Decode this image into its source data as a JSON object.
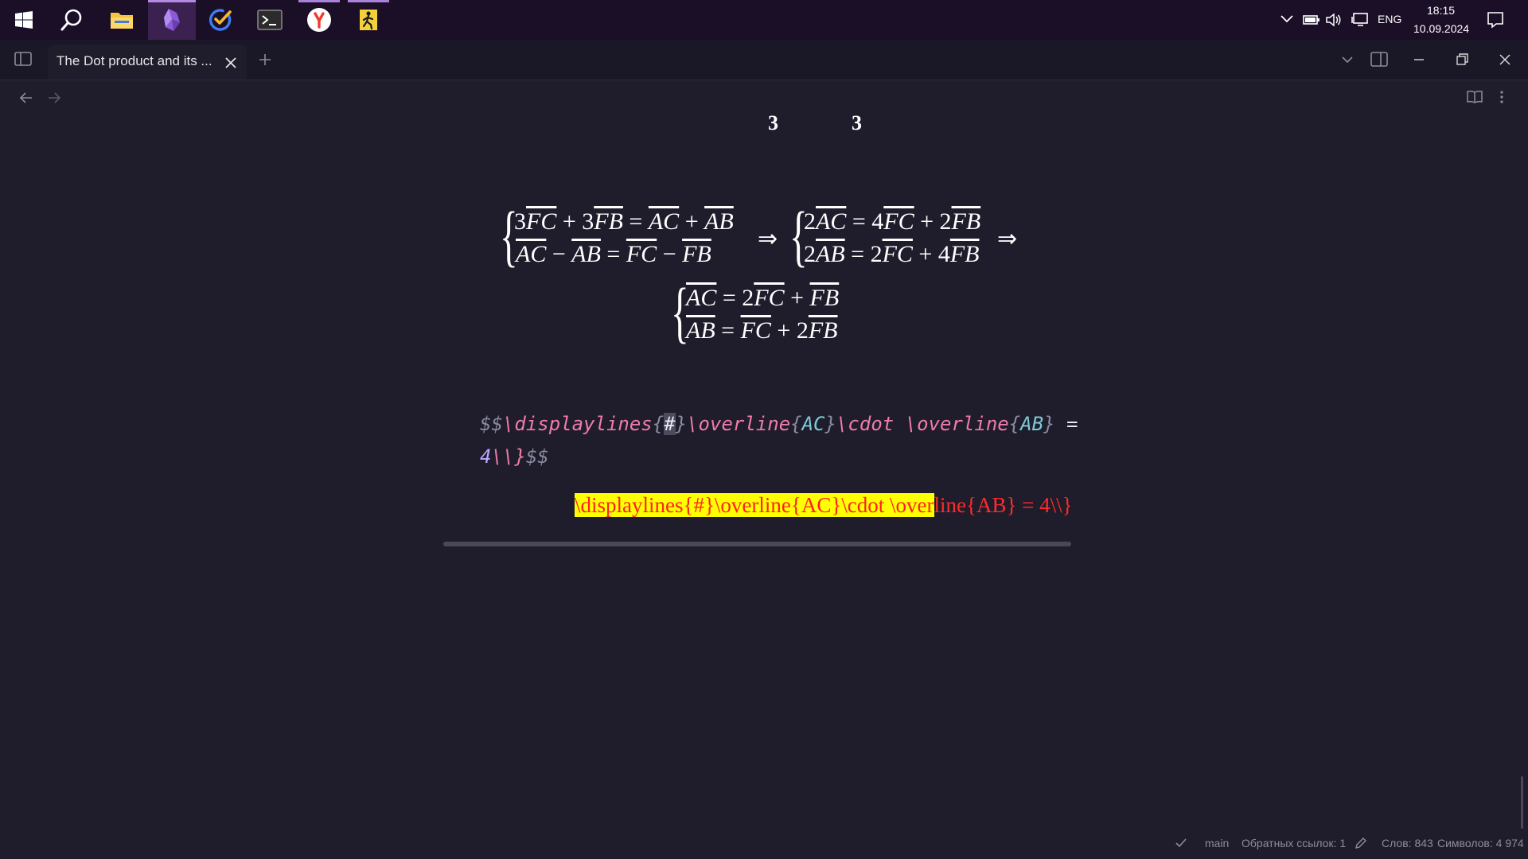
{
  "taskbar": {
    "apps": [
      {
        "name": "start-icon"
      },
      {
        "name": "search-icon"
      },
      {
        "name": "file-explorer-icon"
      },
      {
        "name": "obsidian-icon"
      },
      {
        "name": "todo-check-icon"
      },
      {
        "name": "terminal-icon"
      },
      {
        "name": "yandex-browser-icon"
      },
      {
        "name": "exit-app-icon"
      }
    ],
    "language": "ENG",
    "time": "18:15",
    "date": "10.09.2024"
  },
  "tab": {
    "title": "The Dot product and its ..."
  },
  "content": {
    "partial_line": [
      "3",
      "3"
    ],
    "system1": {
      "row1": {
        "c1": "3",
        "v1": "FC",
        "c2": "3",
        "v2": "FB",
        "v3": "AC",
        "v4": "AB"
      },
      "row2": {
        "v1": "AC",
        "v2": "AB",
        "v3": "FC",
        "v4": "FB"
      }
    },
    "system2": {
      "row1": {
        "c1": "2",
        "v1": "AC",
        "c2": "4",
        "v2": "FC",
        "c3": "2",
        "v3": "FB"
      },
      "row2": {
        "c1": "2",
        "v1": "AB",
        "c2": "2",
        "v2": "FC",
        "c3": "4",
        "v3": "FB"
      }
    },
    "system3": {
      "row1": {
        "v1": "AC",
        "c1": "2",
        "v2": "FC",
        "v3": "FB"
      },
      "row2": {
        "v1": "AB",
        "v2": "FC",
        "c1": "2",
        "v3": "FB"
      }
    },
    "source": {
      "open": "$$",
      "cmd1": "\\displaylines",
      "brace_open": "{",
      "hash": "#",
      "brace_close": "}",
      "cmd2": "\\overline",
      "arg1_open": "{",
      "arg1": "AC",
      "arg1_close": "}",
      "cmd3": "\\cdot",
      "cmd4": "\\overline",
      "arg2_open": "{",
      "arg2": "AB",
      "arg2_close": "}",
      "eq": "=",
      "line2_num": "4",
      "line2_esc": "\\\\}",
      "close": "$$"
    },
    "error": {
      "highlighted": "\\displaylines{#}\\overline{AC}\\cdot \\over",
      "rest": "line{AB} = 4\\\\}"
    }
  },
  "statusbar": {
    "branch": "main",
    "backlinks": "Обратных ссылок: 1",
    "words": "Слов: 843",
    "chars": "Символов: 4 974"
  },
  "colors": {
    "background": "#1f1d2b",
    "taskbar": "#1b0f28",
    "syntax_command": "#f07ca9",
    "syntax_argument": "#7ec8d8",
    "error_text": "#ff2b2b",
    "error_highlight": "#ffff00"
  }
}
